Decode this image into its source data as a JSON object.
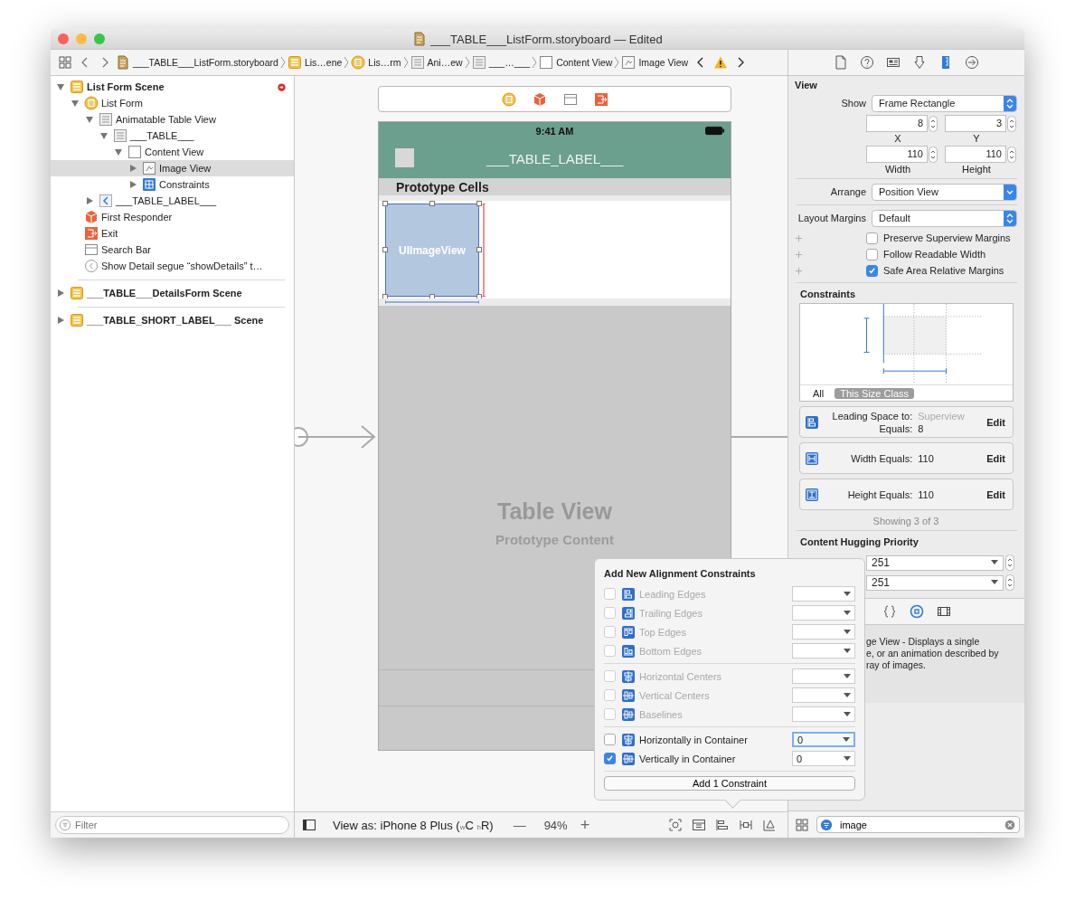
{
  "window": {
    "title": "___TABLE___ListForm.storyboard — Edited"
  },
  "breadcrumb": [
    {
      "kind": "file",
      "label": "___TABLE___ListForm.storyboard"
    },
    {
      "kind": "scene",
      "label": "Lis…ene"
    },
    {
      "kind": "controller",
      "label": "Lis…rm"
    },
    {
      "kind": "table",
      "label": "Ani…ew"
    },
    {
      "kind": "table",
      "label": "___…___"
    },
    {
      "kind": "view",
      "label": "Content View"
    },
    {
      "kind": "image",
      "label": "Image View"
    }
  ],
  "outline": [
    {
      "kind": "scene",
      "label": "List Form Scene",
      "expanded": true,
      "selected": false,
      "error": true,
      "children": [
        {
          "kind": "controller",
          "label": "List Form",
          "expanded": true,
          "selected": false,
          "children": [
            {
              "kind": "table",
              "label": "Animatable Table View",
              "expanded": true,
              "selected": false,
              "children": [
                {
                  "kind": "table",
                  "label": "___TABLE___",
                  "expanded": true,
                  "selected": false,
                  "children": [
                    {
                      "kind": "view",
                      "label": "Content View",
                      "expanded": true,
                      "selected": false,
                      "children": [
                        {
                          "kind": "image",
                          "label": "Image View",
                          "expanded": false,
                          "selected": true
                        },
                        {
                          "kind": "constraints",
                          "label": "Constraints",
                          "expanded": false,
                          "selected": false
                        }
                      ]
                    }
                  ]
                }
              ]
            },
            {
              "kind": "back",
              "label": "___TABLE_LABEL___",
              "expanded": false,
              "selected": false
            }
          ]
        },
        {
          "kind": "responder",
          "label": "First Responder",
          "selected": false
        },
        {
          "kind": "exit",
          "label": "Exit",
          "selected": false
        },
        {
          "kind": "searchbar",
          "label": "Search Bar",
          "selected": false
        },
        {
          "kind": "segue",
          "label": "Show Detail segue “showDetails” t…",
          "selected": false
        }
      ]
    },
    {
      "kind": "scene",
      "label": "___TABLE___DetailsForm Scene",
      "expanded": false,
      "selected": false,
      "error": false
    },
    {
      "kind": "scene",
      "label": "___TABLE_SHORT_LABEL___ Scene",
      "expanded": false,
      "selected": false,
      "error": false
    }
  ],
  "outline_filter": {
    "placeholder": "Filter"
  },
  "canvas": {
    "dock": [
      {
        "kind": "controller"
      },
      {
        "kind": "responder"
      },
      {
        "kind": "searchbar"
      },
      {
        "kind": "exit"
      }
    ],
    "status_time": "9:41 AM",
    "nav_title": "___TABLE_LABEL___",
    "section_header": "Prototype Cells",
    "image_view_label": "UIImageView",
    "table_title": "Table View",
    "table_subtitle": "Prototype Content",
    "view_as": "View as: iPhone 8 Plus ($_{w}$C $_{h}$R)",
    "zoom_out": "—",
    "zoom": "94%",
    "zoom_in": "+"
  },
  "inspector_tabs": [
    {
      "kind": "file",
      "selected": false
    },
    {
      "kind": "help",
      "selected": false
    },
    {
      "kind": "identity",
      "selected": false
    },
    {
      "kind": "attributes",
      "selected": false
    },
    {
      "kind": "size",
      "selected": true
    },
    {
      "kind": "connections",
      "selected": false
    }
  ],
  "view": {
    "title": "View",
    "show_label": "Show",
    "show": "Frame Rectangle",
    "fields": [
      {
        "label": "X",
        "value": "8"
      },
      {
        "label": "Y",
        "value": "3"
      },
      {
        "label": "Width",
        "value": "110"
      },
      {
        "label": "Height",
        "value": "110"
      }
    ],
    "arrange_label": "Arrange",
    "arrange": "Position View",
    "margins_label": "Layout Margins",
    "margins": "Default",
    "options": [
      {
        "label": "Preserve Superview Margins",
        "checked": false
      },
      {
        "label": "Follow Readable Width",
        "checked": false
      },
      {
        "label": "Safe Area Relative Margins",
        "checked": true
      }
    ]
  },
  "constraints": {
    "title": "Constraints",
    "size_tabs": [
      {
        "label": "All",
        "selected": false
      },
      {
        "label": "This Size Class",
        "selected": true
      }
    ],
    "items": [
      {
        "kind": "leading",
        "action": "Edit",
        "lines": [
          {
            "label": "Leading Space to:",
            "value": "Superview",
            "dim": true
          },
          {
            "label": "Equals:",
            "value": "8",
            "dim": false
          }
        ]
      },
      {
        "kind": "width",
        "action": "Edit",
        "lines": [
          {
            "label": "Width Equals:",
            "value": "110",
            "dim": false
          }
        ]
      },
      {
        "kind": "height",
        "action": "Edit",
        "lines": [
          {
            "label": "Height Equals:",
            "value": "110",
            "dim": false
          }
        ]
      }
    ],
    "count": "Showing 3 of 3"
  },
  "hugging": {
    "title": "Content Hugging Priority",
    "values": [
      "251",
      "251"
    ]
  },
  "library_tabs": [
    {
      "kind": "braces",
      "selected": false
    },
    {
      "kind": "object",
      "selected": true
    },
    {
      "kind": "media",
      "selected": false
    }
  ],
  "library_description": [
    "ge View - Displays a single",
    "e, or an animation described by",
    "ray of images."
  ],
  "library_search": {
    "value": "image"
  },
  "popover": {
    "title": "Add New Alignment Constraints",
    "groups": [
      [
        {
          "kind": "leading",
          "label": "Leading Edges",
          "checked": false,
          "disabled": true,
          "focused": false
        },
        {
          "kind": "trailing",
          "label": "Trailing Edges",
          "checked": false,
          "disabled": true,
          "focused": false
        },
        {
          "kind": "top",
          "label": "Top Edges",
          "checked": false,
          "disabled": true,
          "focused": false
        },
        {
          "kind": "bottom",
          "label": "Bottom Edges",
          "checked": false,
          "disabled": true,
          "focused": false
        }
      ],
      [
        {
          "kind": "hcenter",
          "label": "Horizontal Centers",
          "checked": false,
          "disabled": true,
          "focused": false
        },
        {
          "kind": "vcenter",
          "label": "Vertical Centers",
          "checked": false,
          "disabled": true,
          "focused": false
        },
        {
          "kind": "vcenter",
          "label": "Baselines",
          "checked": false,
          "disabled": true,
          "focused": false
        }
      ],
      [
        {
          "kind": "hcenter",
          "label": "Horizontally in Container",
          "checked": false,
          "disabled": false,
          "focused": true,
          "value": "0"
        },
        {
          "kind": "vcenter",
          "label": "Vertically in Container",
          "checked": true,
          "disabled": false,
          "focused": false,
          "value": "0"
        }
      ]
    ],
    "button": "Add 1 Constraint"
  }
}
